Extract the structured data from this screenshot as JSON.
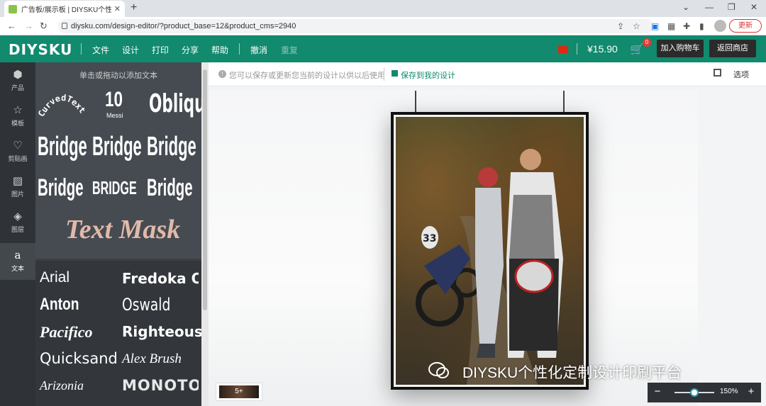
{
  "browser": {
    "tab_title": "广告板/展示板 | DIYSKU个性化定",
    "url": "diysku.com/design-editor/?product_base=12&product_cms=2940",
    "update_label": "更新"
  },
  "header": {
    "logo": "DIYSKU",
    "menu": [
      "文件",
      "设计",
      "打印",
      "分享",
      "帮助"
    ],
    "undo": "撤消",
    "redo": "重复",
    "price": "¥15.90",
    "cart_count": "0",
    "add_to_cart": "加入购物车",
    "back_to_shop": "返回商店"
  },
  "sidebar": {
    "items": [
      {
        "label": "产品",
        "icon": "cube-icon"
      },
      {
        "label": "模板",
        "icon": "star-icon"
      },
      {
        "label": "剪贴画",
        "icon": "heart-icon"
      },
      {
        "label": "图片",
        "icon": "image-icon"
      },
      {
        "label": "图层",
        "icon": "layers-icon"
      },
      {
        "label": "文本",
        "icon": "text-icon"
      }
    ]
  },
  "text_panel": {
    "hint": "单击或拖动以添加文本",
    "styles": {
      "curved": "CurvedText",
      "ten": "10",
      "messi": "Messi",
      "oblique": "Obliqu",
      "bridge": "Bridge",
      "bridge_caps": "BRIDGE",
      "text_mask": "Text Mask"
    },
    "fonts": [
      "Arial",
      "Fredoka One",
      "Anton",
      "Oswald",
      "Pacifico",
      "Righteous",
      "Quicksand",
      "Alex Brush",
      "Arizonia",
      "MONOTON"
    ]
  },
  "toolbar": {
    "info": "您可以保存或更新您当前的设计以供以后使用",
    "save": "保存到我的设计",
    "options": "选项"
  },
  "canvas": {
    "watermark": "DIYSKU个性化定制设计印刷平台",
    "page_thumb": "5+",
    "zoom": "150%"
  }
}
